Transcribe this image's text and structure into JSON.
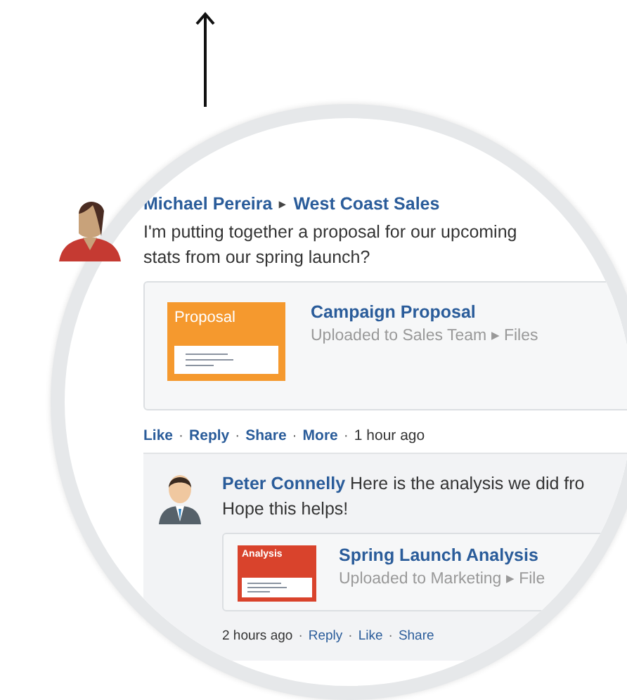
{
  "post": {
    "author": "Michael Pereira",
    "separator": "▸",
    "group": "West Coast Sales",
    "lines": [
      "I'm putting together a proposal for our upcoming",
      "stats from our spring launch?"
    ],
    "attachment": {
      "thumbnail_label": "Proposal",
      "title": "Campaign Proposal",
      "location": "Uploaded to Sales Team ▸ Files"
    },
    "action_separator": "·",
    "actions": [
      {
        "label": "Like",
        "kind": "link"
      },
      {
        "label": "Reply",
        "kind": "link"
      },
      {
        "label": "Share",
        "kind": "link"
      },
      {
        "label": "More",
        "kind": "link"
      },
      {
        "label": "1 hour ago",
        "kind": "time"
      }
    ]
  },
  "reply": {
    "author": "Peter Connelly",
    "lines": [
      "Here is the analysis we did fro",
      "Hope this helps!"
    ],
    "attachment": {
      "thumbnail_label": "Analysis",
      "title": "Spring Launch Analysis",
      "location": "Uploaded to Marketing ▸ File"
    },
    "action_separator": "·",
    "actions": [
      {
        "label": "2 hours ago",
        "kind": "time"
      },
      {
        "label": "Reply",
        "kind": "link"
      },
      {
        "label": "Like",
        "kind": "link"
      },
      {
        "label": "Share",
        "kind": "link"
      }
    ]
  }
}
